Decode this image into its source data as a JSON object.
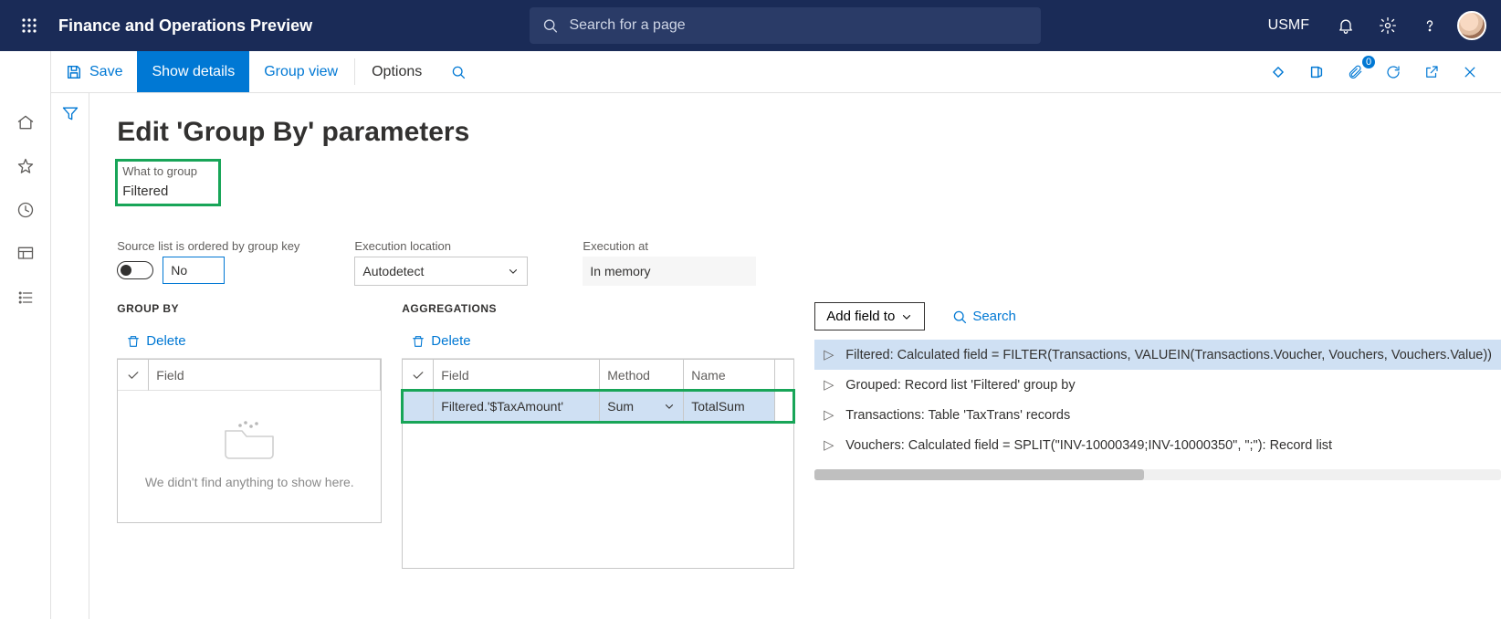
{
  "topbar": {
    "app_title": "Finance and Operations Preview",
    "search_placeholder": "Search for a page",
    "legal_entity": "USMF"
  },
  "cmdbar": {
    "save": "Save",
    "show_details": "Show details",
    "group_view": "Group view",
    "options": "Options",
    "attachments_count": "0"
  },
  "page": {
    "title": "Edit 'Group By' parameters",
    "what_to_group_label": "What to group",
    "what_to_group_value": "Filtered",
    "ordered_label": "Source list is ordered by group key",
    "ordered_value": "No",
    "exec_loc_label": "Execution location",
    "exec_loc_value": "Autodetect",
    "exec_at_label": "Execution at",
    "exec_at_value": "In memory"
  },
  "groupby": {
    "header": "Group by",
    "delete": "Delete",
    "col_field": "Field",
    "empty": "We didn't find anything to show here."
  },
  "aggregations": {
    "header": "Aggregations",
    "delete": "Delete",
    "col_field": "Field",
    "col_method": "Method",
    "col_name": "Name",
    "rows": [
      {
        "field": "Filtered.'$TaxAmount'",
        "method": "Sum",
        "name": "TotalSum"
      }
    ]
  },
  "data_sources": {
    "add_field_to": "Add field to",
    "search": "Search",
    "items": [
      {
        "text": "Filtered: Calculated field = FILTER(Transactions, VALUEIN(Transactions.Voucher, Vouchers, Vouchers.Value))",
        "selected": true
      },
      {
        "text": "Grouped: Record list 'Filtered' group by",
        "selected": false
      },
      {
        "text": "Transactions: Table 'TaxTrans' records",
        "selected": false
      },
      {
        "text": "Vouchers: Calculated field = SPLIT(\"INV-10000349;INV-10000350\", \";\"): Record list",
        "selected": false
      }
    ]
  }
}
